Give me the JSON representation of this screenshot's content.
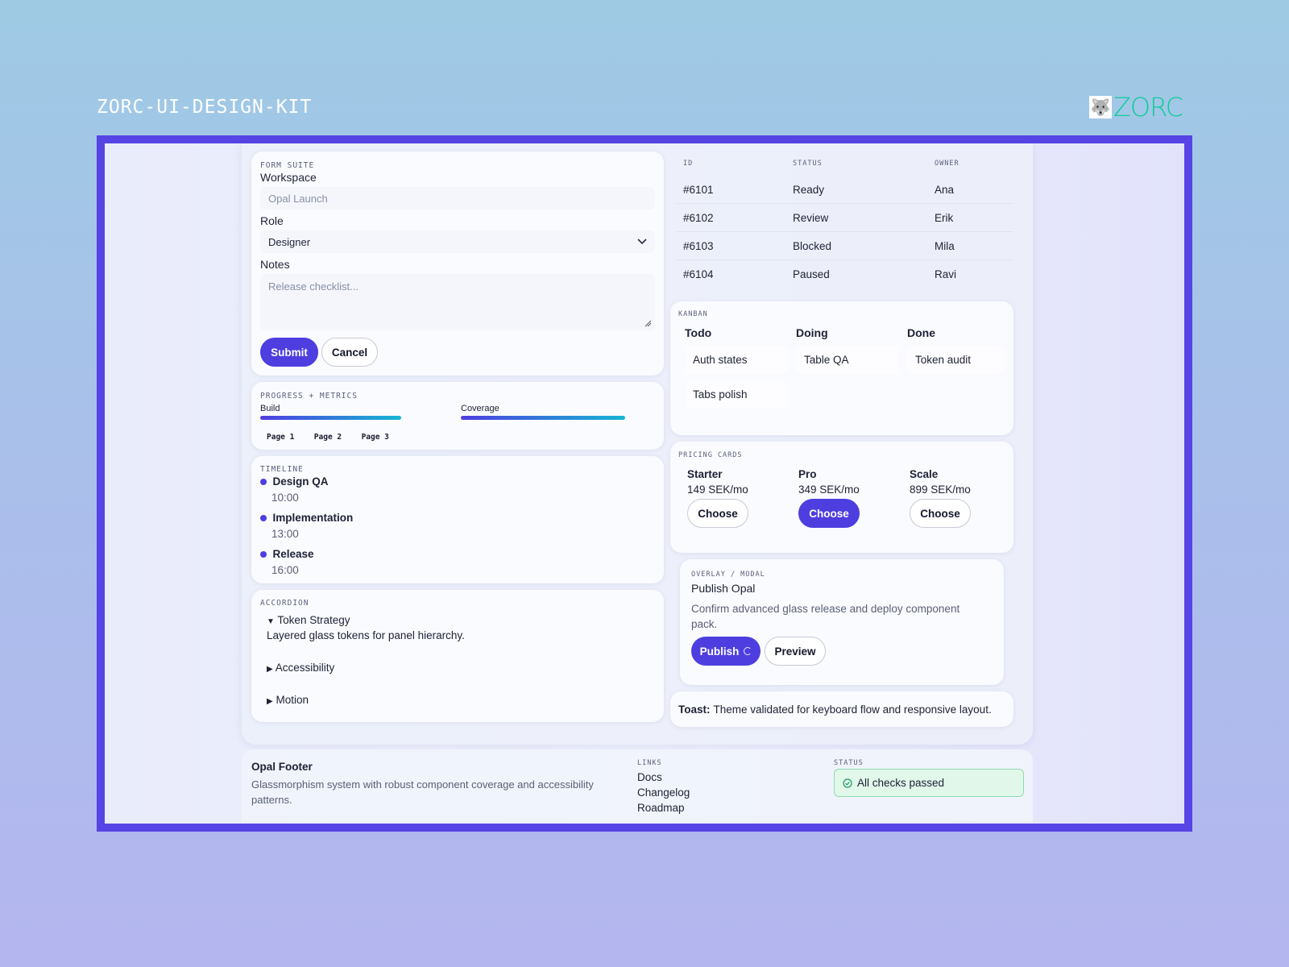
{
  "kit_title": "ZORC-UI-DESIGN-KIT",
  "brand": {
    "wordmark": "ZORC",
    "accent": "#12c99b"
  },
  "colors": {
    "primary": "#4e3ee0",
    "frame": "#5644e4"
  },
  "form": {
    "eyebrow": "FORM SUITE",
    "workspace_label": "Workspace",
    "workspace_placeholder": "Opal Launch",
    "role_label": "Role",
    "role_value": "Designer",
    "notes_label": "Notes",
    "notes_placeholder": "Release checklist...",
    "submit": "Submit",
    "cancel": "Cancel"
  },
  "progress": {
    "eyebrow": "PROGRESS + METRICS",
    "bars": [
      {
        "label": "Build",
        "value": 0.76
      },
      {
        "label": "Coverage",
        "value": 0.88
      }
    ],
    "pages": [
      "Page 1",
      "Page 2",
      "Page 3"
    ]
  },
  "timeline": {
    "eyebrow": "TIMELINE",
    "items": [
      {
        "title": "Design QA",
        "time": "10:00"
      },
      {
        "title": "Implementation",
        "time": "13:00"
      },
      {
        "title": "Release",
        "time": "16:00"
      }
    ]
  },
  "accordion": {
    "eyebrow": "ACCORDION",
    "open": {
      "title": "Token Strategy",
      "body": "Layered glass tokens for panel hierarchy."
    },
    "closed": [
      "Accessibility",
      "Motion"
    ]
  },
  "table": {
    "headers": [
      "ID",
      "STATUS",
      "OWNER"
    ],
    "rows": [
      [
        "#6101",
        "Ready",
        "Ana"
      ],
      [
        "#6102",
        "Review",
        "Erik"
      ],
      [
        "#6103",
        "Blocked",
        "Mila"
      ],
      [
        "#6104",
        "Paused",
        "Ravi"
      ]
    ]
  },
  "kanban": {
    "eyebrow": "KANBAN",
    "columns": [
      {
        "title": "Todo",
        "cards": [
          "Auth states",
          "Tabs polish"
        ]
      },
      {
        "title": "Doing",
        "cards": [
          "Table QA"
        ]
      },
      {
        "title": "Done",
        "cards": [
          "Token audit"
        ]
      }
    ]
  },
  "pricing": {
    "eyebrow": "PRICING CARDS",
    "plans": [
      {
        "name": "Starter",
        "price": "149 SEK/mo",
        "cta": "Choose"
      },
      {
        "name": "Pro",
        "price": "349 SEK/mo",
        "cta": "Choose"
      },
      {
        "name": "Scale",
        "price": "899 SEK/mo",
        "cta": "Choose"
      }
    ]
  },
  "modal": {
    "eyebrow": "OVERLAY / MODAL",
    "title": "Publish Opal",
    "body": "Confirm advanced glass release and deploy component pack.",
    "publish": "Publish",
    "preview": "Preview"
  },
  "toast": {
    "label": "Toast:",
    "text": "Theme validated for keyboard flow and responsive layout."
  },
  "footer": {
    "title": "Opal Footer",
    "desc": "Glassmorphism system with robust component coverage and accessibility patterns.",
    "links_eyebrow": "LINKS",
    "links": [
      "Docs",
      "Changelog",
      "Roadmap"
    ],
    "status_eyebrow": "STATUS",
    "status_text": "All checks passed"
  }
}
